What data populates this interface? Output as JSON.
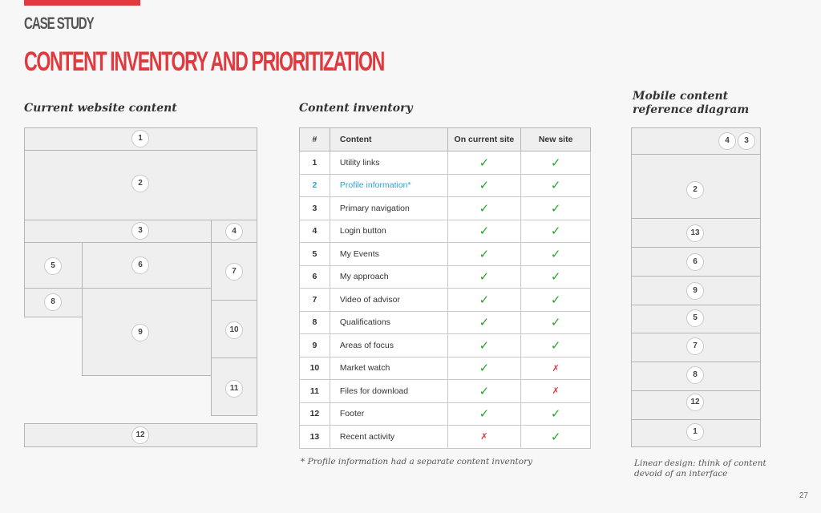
{
  "header": {
    "kicker": "CASE STUDY",
    "title": "CONTENT INVENTORY AND PRIORITIZATION"
  },
  "columns": {
    "current_title": "Current website content",
    "inventory_title": "Content inventory",
    "mobile_title": "Mobile content reference diagram"
  },
  "wireframe": {
    "labels": [
      "1",
      "2",
      "3",
      "4",
      "5",
      "6",
      "7",
      "8",
      "9",
      "10",
      "11",
      "12"
    ]
  },
  "inventory": {
    "headers": [
      "#",
      "Content",
      "On current site",
      "New site"
    ],
    "rows": [
      {
        "n": "1",
        "content": "Utility links",
        "current": "✓",
        "new": "✓"
      },
      {
        "n": "2",
        "content": "Profile information*",
        "current": "✓",
        "new": "✓"
      },
      {
        "n": "3",
        "content": "Primary navigation",
        "current": "✓",
        "new": "✓"
      },
      {
        "n": "4",
        "content": "Login button",
        "current": "✓",
        "new": "✓"
      },
      {
        "n": "5",
        "content": "My Events",
        "current": "✓",
        "new": "✓"
      },
      {
        "n": "6",
        "content": "My approach",
        "current": "✓",
        "new": "✓"
      },
      {
        "n": "7",
        "content": "Video of advisor",
        "current": "✓",
        "new": "✓"
      },
      {
        "n": "8",
        "content": "Qualifications",
        "current": "✓",
        "new": "✓"
      },
      {
        "n": "9",
        "content": "Areas of focus",
        "current": "✓",
        "new": "✓"
      },
      {
        "n": "10",
        "content": "Market watch",
        "current": "✓",
        "new": "✗"
      },
      {
        "n": "11",
        "content": "Files for download",
        "current": "✓",
        "new": "✗"
      },
      {
        "n": "12",
        "content": "Footer",
        "current": "✓",
        "new": "✓"
      },
      {
        "n": "13",
        "content": "Recent activity",
        "current": "✗",
        "new": "✓"
      }
    ],
    "footnote": "* Profile information had a separate content inventory"
  },
  "mobile": {
    "top_labels": [
      "4",
      "3"
    ],
    "rows": [
      "2",
      "13",
      "6",
      "9",
      "5",
      "7",
      "8",
      "12",
      "1"
    ],
    "caption": "Linear design: think of content devoid of an interface"
  },
  "colors": {
    "accent": "#e0393e",
    "check": "#29a329",
    "link": "#2aa3d8"
  },
  "page_number": "27"
}
